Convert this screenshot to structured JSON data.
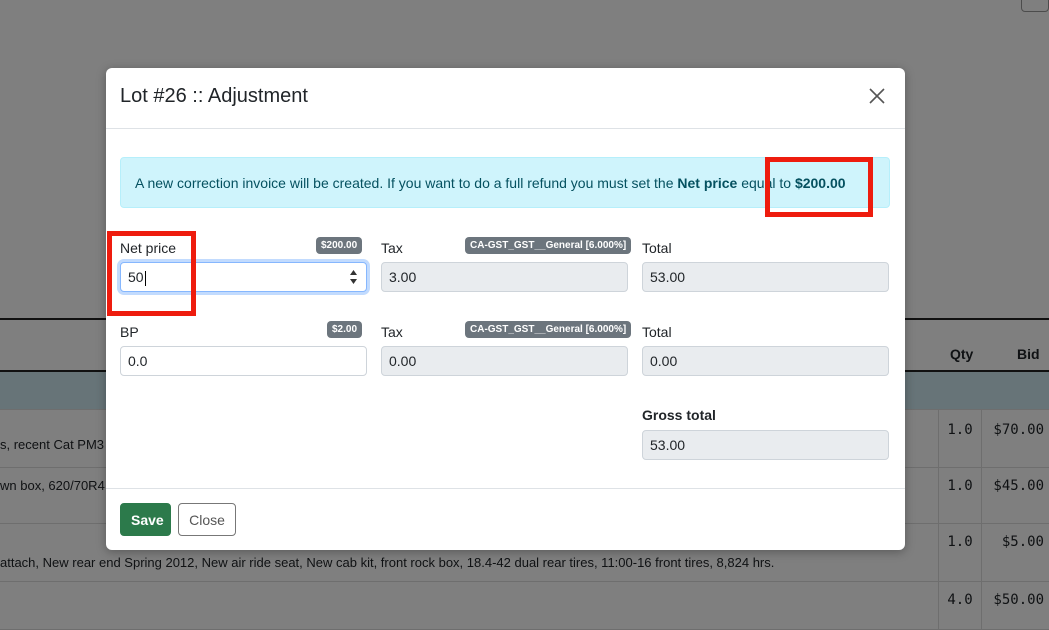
{
  "background": {
    "table": {
      "headers": {
        "qty": "Qty",
        "bid": "Bid"
      },
      "rows": [
        {
          "desc": "s, recent Cat PM3",
          "qty": "1.0",
          "bid": "$70.00"
        },
        {
          "desc": "wn box, 620/70R4",
          "qty": "1.0",
          "bid": "$45.00"
        },
        {
          "desc": "attach, New rear end Spring 2012, New air ride seat, New cab kit, front rock box, 18.4-42 dual rear tires, 11:00-16 front tires, 8,824 hrs.",
          "qty": "1.0",
          "bid": "$5.00"
        },
        {
          "desc": "",
          "qty": "4.0",
          "bid": "$50.00"
        }
      ]
    }
  },
  "modal": {
    "title": "Lot #26 :: Adjustment",
    "alert": {
      "text_before": "A new correction invoice will be created. If you want to do a full refund you must set the ",
      "bold_label": "Net price",
      "text_after": " equal to ",
      "amount": "$200.00"
    },
    "row1": {
      "net_price_label": "Net price",
      "net_price_badge": "$200.00",
      "net_price_value": "50",
      "tax_label": "Tax",
      "tax_badge": "CA-GST_GST__General [6.000%]",
      "tax_value": "3.00",
      "total_label": "Total",
      "total_value": "53.00"
    },
    "row2": {
      "bp_label": "BP",
      "bp_badge": "$2.00",
      "bp_value": "0.0",
      "tax_label": "Tax",
      "tax_badge": "CA-GST_GST__General [6.000%]",
      "tax_value": "0.00",
      "total_label": "Total",
      "total_value": "0.00"
    },
    "gross": {
      "label": "Gross total",
      "value": "53.00"
    },
    "footer": {
      "save_label": "Save",
      "close_label": "Close"
    }
  },
  "colors": {
    "annotation_red": "#ee1c0e",
    "save_green": "#2c7a4b",
    "alert_bg": "#cff4fc"
  }
}
